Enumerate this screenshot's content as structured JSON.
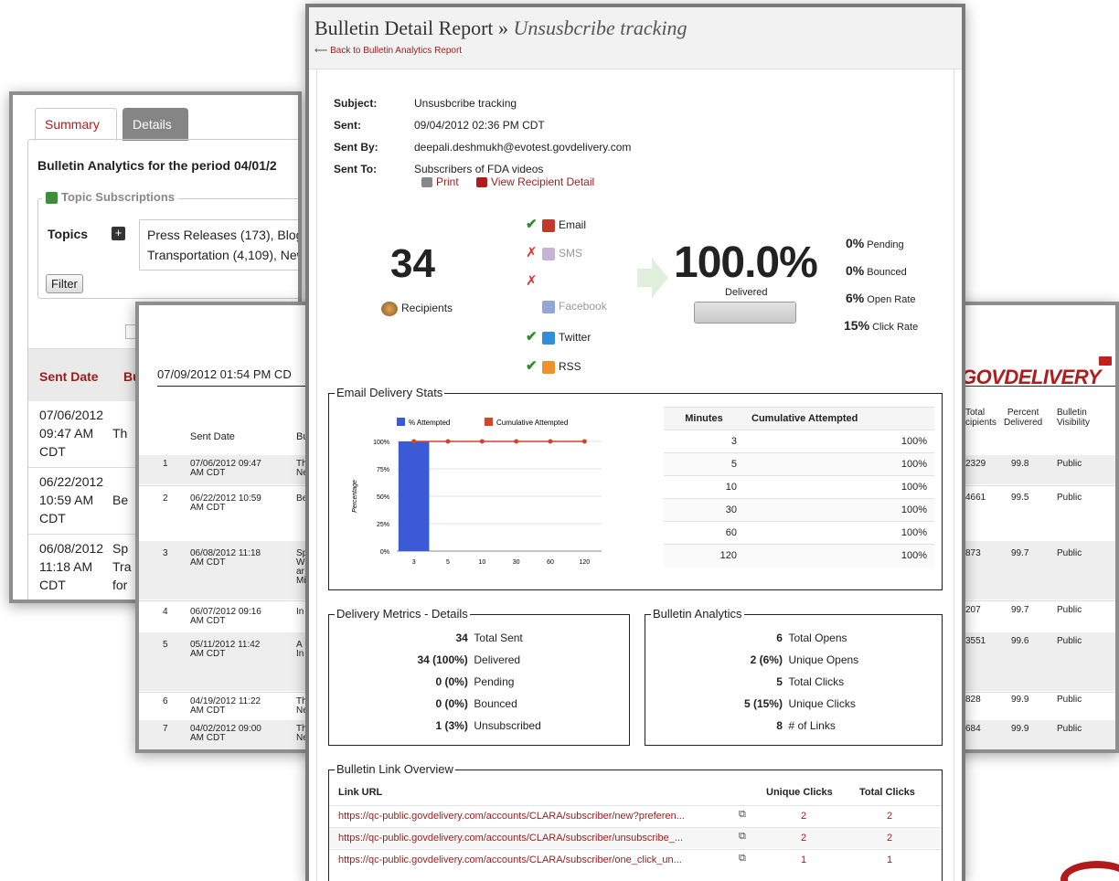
{
  "summary_window": {
    "tabs": [
      {
        "label": "Summary"
      },
      {
        "label": "Details"
      }
    ],
    "period_title": "Bulletin Analytics for the period 04/01/2",
    "topic_subscriptions_legend": "Topic Subscriptions",
    "topics_label": "Topics",
    "topics_line1": "Press Releases (173), Blog",
    "topics_line2": "Transportation (4,109), New",
    "filter_label": "Filter",
    "col_sent_date": "Sent Date",
    "col_bu": "Bu",
    "rows": [
      {
        "date": "07/06/2012",
        "time": "09:47 AM",
        "tz": "CDT",
        "subject": "Th"
      },
      {
        "date": "06/22/2012",
        "time": "10:59 AM",
        "tz": "CDT",
        "subject": "Be"
      },
      {
        "date": "06/08/2012",
        "time": "11:18 AM",
        "tz": "CDT",
        "subject": "Sp",
        "subject2": "Tra",
        "subject3": "for"
      }
    ]
  },
  "details_window": {
    "date_heading": "07/09/2012 01:54 PM CD",
    "col_sent_date": "Sent Date",
    "col_bu": "Bu",
    "logo_text": "GOVDELIVERY",
    "col_total": "Total",
    "col_total2": "cipients",
    "col_percent": "Percent",
    "col_percent2": "Delivered",
    "col_visibility": "Bulletin",
    "col_visibility2": "Visibility",
    "rows": [
      {
        "n": "1",
        "d1": "07/06/2012 09:47",
        "d2": "AM CDT",
        "s1": "Th",
        "s2": "Ne",
        "total": "2329",
        "pct": "99.8",
        "vis": "Public"
      },
      {
        "n": "2",
        "d1": "06/22/2012 10:59",
        "d2": "AM CDT",
        "s1": "Be",
        "s2": "",
        "total": "4661",
        "pct": "99.5",
        "vis": "Public"
      },
      {
        "n": "3",
        "d1": "06/08/2012 11:18",
        "d2": "AM CDT",
        "s1": "Sp",
        "s2": "Wi",
        "s3": "ar",
        "s4": "Mi",
        "total": "873",
        "pct": "99.7",
        "vis": "Public"
      },
      {
        "n": "4",
        "d1": "06/07/2012 09:16",
        "d2": "AM CDT",
        "s1": "In",
        "s2": "",
        "total": "207",
        "pct": "99.7",
        "vis": "Public"
      },
      {
        "n": "5",
        "d1": "05/11/2012 11:42",
        "d2": "AM CDT",
        "s1": "A",
        "s2": "In",
        "total": "3551",
        "pct": "99.6",
        "vis": "Public"
      },
      {
        "n": "6",
        "d1": "04/19/2012 11:22",
        "d2": "AM CDT",
        "s1": "Th",
        "s2": "Ne",
        "total": "828",
        "pct": "99.9",
        "vis": "Public"
      },
      {
        "n": "7",
        "d1": "04/02/2012 09:00",
        "d2": "AM CDT",
        "s1": "Th",
        "s2": "Ne",
        "total": "684",
        "pct": "99.9",
        "vis": "Public"
      }
    ]
  },
  "report": {
    "title_plain": "Bulletin Detail Report »",
    "title_italic": "Unsusbcribe tracking",
    "back_link": "Back to Bulletin Analytics Report",
    "subject_label": "Subject:",
    "subject": "Unsusbcribe tracking",
    "sent_label": "Sent:",
    "sent": "09/04/2012 02:36 PM CDT",
    "sentby_label": "Sent By:",
    "sentby": "deepali.deshmukh@evotest.govdelivery.com",
    "sentto_label": "Sent To:",
    "sentto": "Subscribers of FDA videos",
    "print_label": "Print",
    "view_recipient_label": "View Recipient Detail",
    "recipients_count": "34",
    "recipients_label": "Recipients",
    "channels": [
      {
        "name": "Email",
        "status": "✔",
        "enabled": true
      },
      {
        "name": "SMS",
        "status": "✗",
        "enabled": false
      },
      {
        "name": "",
        "status": "✗",
        "enabled": false
      },
      {
        "name": "Facebook",
        "status": "",
        "enabled": false
      },
      {
        "name": "Twitter",
        "status": "✔",
        "enabled": true
      },
      {
        "name": "RSS",
        "status": "✔",
        "enabled": true
      }
    ],
    "delivered_pct": "100.0%",
    "delivered_label": "Delivered",
    "delivered_fraction": 1.0,
    "rates": [
      {
        "value": "0%",
        "label": "Pending"
      },
      {
        "value": "0%",
        "label": "Bounced"
      },
      {
        "value": "6%",
        "label": "Open Rate"
      },
      {
        "value": "15%",
        "label": "Click Rate"
      }
    ],
    "email_stats_legend": "Email Delivery Stats",
    "minutes_table": {
      "headers": [
        "Minutes",
        "Cumulative Attempted"
      ],
      "rows": [
        [
          "3",
          "100%"
        ],
        [
          "5",
          "100%"
        ],
        [
          "10",
          "100%"
        ],
        [
          "30",
          "100%"
        ],
        [
          "60",
          "100%"
        ],
        [
          "120",
          "100%"
        ]
      ]
    },
    "metrics_legend": "Delivery Metrics - Details",
    "metrics": [
      {
        "value": "34",
        "label": "Total Sent"
      },
      {
        "value": "34 (100%)",
        "label": "Delivered"
      },
      {
        "value": "0 (0%)",
        "label": "Pending"
      },
      {
        "value": "0 (0%)",
        "label": "Bounced"
      },
      {
        "value": "1 (3%)",
        "label": "Unsubscribed"
      }
    ],
    "analytics_legend": "Bulletin Analytics",
    "analytics": [
      {
        "value": "6",
        "label": "Total Opens"
      },
      {
        "value": "2 (6%)",
        "label": "Unique Opens"
      },
      {
        "value": "5",
        "label": "Total Clicks"
      },
      {
        "value": "5 (15%)",
        "label": "Unique Clicks"
      },
      {
        "value": "8",
        "label": "# of Links"
      }
    ],
    "links_legend": "Bulletin Link Overview",
    "links_headers": [
      "Link URL",
      "Unique Clicks",
      "Total Clicks"
    ],
    "links": [
      {
        "url": "https://qc-public.govdelivery.com/accounts/CLARA/subscriber/new?preferen...",
        "unique": "2",
        "total": "2"
      },
      {
        "url": "https://qc-public.govdelivery.com/accounts/CLARA/subscriber/unsubscribe_...",
        "unique": "2",
        "total": "2"
      },
      {
        "url": "https://qc-public.govdelivery.com/accounts/CLARA/subscriber/one_click_un...",
        "unique": "1",
        "total": "1"
      }
    ]
  },
  "colors": {
    "accent_red": "#9b1c1c",
    "bar_blue": "#3b5bd6",
    "line_red": "#d0452c",
    "check_green": "#2e8b2e",
    "cross_red": "#d33"
  },
  "chart_data": {
    "type": "bar",
    "categories": [
      "3",
      "5",
      "10",
      "30",
      "60",
      "120"
    ],
    "series": [
      {
        "name": "% Attempted",
        "values": [
          100,
          0,
          0,
          0,
          0,
          0
        ]
      },
      {
        "name": "Cumulative Attempted",
        "values": [
          100,
          100,
          100,
          100,
          100,
          100
        ]
      }
    ],
    "ylabel": "Percentage",
    "y_ticks": [
      "100%",
      "75%",
      "50%",
      "25%",
      "0%"
    ],
    "ylim": [
      0,
      100
    ],
    "legend": "top"
  }
}
